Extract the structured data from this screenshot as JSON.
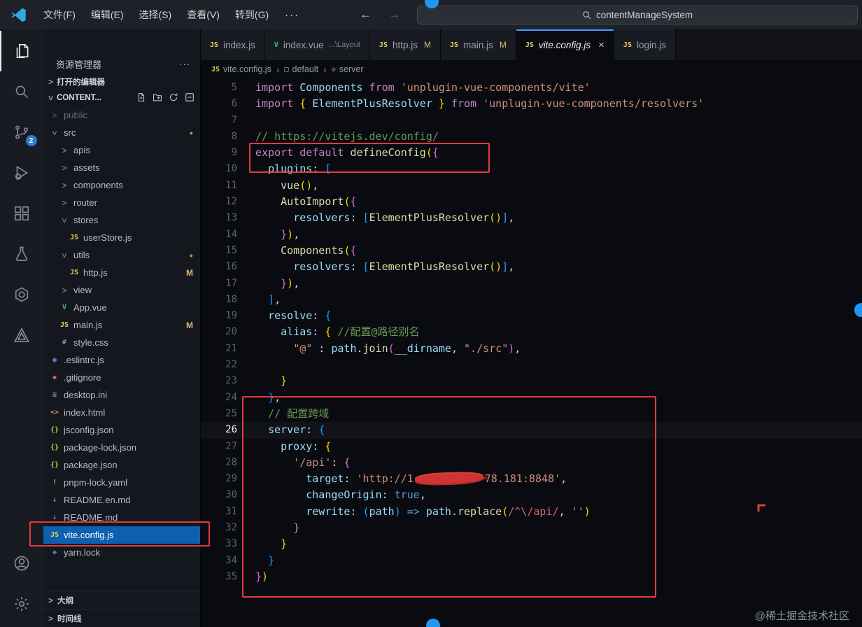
{
  "titlebar": {
    "menus": [
      "文件(F)",
      "编辑(E)",
      "选择(S)",
      "查看(V)",
      "转到(G)"
    ],
    "more": "···",
    "back": "←",
    "forward": "→",
    "search": "contentManageSystem"
  },
  "activity": {
    "items": [
      {
        "name": "explorer",
        "active": true
      },
      {
        "name": "search"
      },
      {
        "name": "source-control",
        "badge": "2"
      },
      {
        "name": "run-debug"
      },
      {
        "name": "extensions"
      },
      {
        "name": "testing"
      },
      {
        "name": "extension-hex"
      },
      {
        "name": "extension-triangle"
      }
    ],
    "bottom": [
      {
        "name": "account"
      },
      {
        "name": "settings"
      }
    ]
  },
  "sidebar": {
    "title": "资源管理器",
    "title_more": "···",
    "open_editors": "打开的编辑器",
    "section": "CONTENT...",
    "outline": "大纲",
    "timeline": "时间线",
    "tree": [
      {
        "label": "public",
        "level": 0,
        "kind": "folder",
        "expanded": false,
        "dim": true
      },
      {
        "label": "src",
        "level": 0,
        "kind": "folder",
        "expanded": true,
        "dot": true
      },
      {
        "label": "apis",
        "level": 1,
        "kind": "folder",
        "expanded": false
      },
      {
        "label": "assets",
        "level": 1,
        "kind": "folder",
        "expanded": false
      },
      {
        "label": "components",
        "level": 1,
        "kind": "folder",
        "expanded": false
      },
      {
        "label": "router",
        "level": 1,
        "kind": "folder",
        "expanded": false
      },
      {
        "label": "stores",
        "level": 1,
        "kind": "folder",
        "expanded": true
      },
      {
        "label": "userStore.js",
        "level": 2,
        "kind": "file",
        "icon": "js"
      },
      {
        "label": "utils",
        "level": 1,
        "kind": "folder",
        "expanded": true,
        "dot": true
      },
      {
        "label": "http.js",
        "level": 2,
        "kind": "file",
        "icon": "js",
        "badge": "M"
      },
      {
        "label": "view",
        "level": 1,
        "kind": "folder",
        "expanded": false
      },
      {
        "label": "App.vue",
        "level": 1,
        "kind": "file",
        "icon": "vue"
      },
      {
        "label": "main.js",
        "level": 1,
        "kind": "file",
        "icon": "js",
        "badge": "M"
      },
      {
        "label": "style.css",
        "level": 1,
        "kind": "file",
        "icon": "css"
      },
      {
        "label": ".eslintrc.js",
        "level": 0,
        "kind": "file",
        "icon": "eslint"
      },
      {
        "label": ".gitignore",
        "level": 0,
        "kind": "file",
        "icon": "git"
      },
      {
        "label": "desktop.ini",
        "level": 0,
        "kind": "file",
        "icon": "ini"
      },
      {
        "label": "index.html",
        "level": 0,
        "kind": "file",
        "icon": "html"
      },
      {
        "label": "jsconfig.json",
        "level": 0,
        "kind": "file",
        "icon": "json"
      },
      {
        "label": "package-lock.json",
        "level": 0,
        "kind": "file",
        "icon": "json"
      },
      {
        "label": "package.json",
        "level": 0,
        "kind": "file",
        "icon": "json"
      },
      {
        "label": "pnpm-lock.yaml",
        "level": 0,
        "kind": "file",
        "icon": "yaml"
      },
      {
        "label": "README.en.md",
        "level": 0,
        "kind": "file",
        "icon": "md"
      },
      {
        "label": "README.md",
        "level": 0,
        "kind": "file",
        "icon": "md"
      },
      {
        "label": "vite.config.js",
        "level": 0,
        "kind": "file",
        "icon": "js",
        "selected": true
      },
      {
        "label": "yarn.lock",
        "level": 0,
        "kind": "file",
        "icon": "lock"
      }
    ]
  },
  "tabs": [
    {
      "icon": "js",
      "label": "index.js"
    },
    {
      "icon": "vue",
      "label": "index.vue",
      "desc": "...\\Layout"
    },
    {
      "icon": "js",
      "label": "http.js",
      "badge": "M"
    },
    {
      "icon": "js",
      "label": "main.js",
      "badge": "M"
    },
    {
      "icon": "js",
      "label": "vite.config.js",
      "active": true,
      "close": "×"
    },
    {
      "icon": "js",
      "label": "login.js"
    }
  ],
  "breadcrumb": [
    {
      "icon": "js",
      "label": "vite.config.js"
    },
    {
      "icon": "box",
      "label": "default"
    },
    {
      "icon": "diamond",
      "label": "server"
    }
  ],
  "code": {
    "active_line": 26,
    "lines": [
      {
        "n": 5,
        "t": [
          [
            "k",
            "import "
          ],
          [
            "v",
            "Components "
          ],
          [
            "k",
            "from "
          ],
          [
            "s",
            "'unplugin-vue-components/vite'"
          ]
        ]
      },
      {
        "n": 6,
        "t": [
          [
            "k",
            "import "
          ],
          [
            "g",
            "{ "
          ],
          [
            "v",
            "ElementPlusResolver"
          ],
          [
            "g",
            " } "
          ],
          [
            "k",
            "from "
          ],
          [
            "s",
            "'unplugin-vue-components/resolvers'"
          ]
        ]
      },
      {
        "n": 7,
        "t": []
      },
      {
        "n": 8,
        "t": [
          [
            "c",
            "// https://vitejs.dev/config/"
          ]
        ]
      },
      {
        "n": 9,
        "t": [
          [
            "k",
            "export default "
          ],
          [
            "f",
            "defineConfig"
          ],
          [
            "g",
            "("
          ],
          [
            "m",
            "{"
          ]
        ]
      },
      {
        "n": 10,
        "t": [
          [
            "p",
            "  "
          ],
          [
            "v",
            "plugins"
          ],
          [
            "p",
            ": "
          ],
          [
            "b",
            "["
          ]
        ]
      },
      {
        "n": 11,
        "t": [
          [
            "p",
            "    "
          ],
          [
            "f",
            "vue"
          ],
          [
            "g",
            "()"
          ],
          [
            "p",
            ","
          ]
        ]
      },
      {
        "n": 12,
        "t": [
          [
            "p",
            "    "
          ],
          [
            "f",
            "AutoImport"
          ],
          [
            "g",
            "("
          ],
          [
            "m",
            "{"
          ]
        ]
      },
      {
        "n": 13,
        "t": [
          [
            "p",
            "      "
          ],
          [
            "v",
            "resolvers"
          ],
          [
            "p",
            ": "
          ],
          [
            "b",
            "["
          ],
          [
            "f",
            "ElementPlusResolver"
          ],
          [
            "g",
            "()"
          ],
          [
            "b",
            "]"
          ],
          [
            "p",
            ","
          ]
        ]
      },
      {
        "n": 14,
        "t": [
          [
            "p",
            "    "
          ],
          [
            "m",
            "}"
          ],
          [
            "g",
            ")"
          ],
          [
            "p",
            ","
          ]
        ]
      },
      {
        "n": 15,
        "t": [
          [
            "p",
            "    "
          ],
          [
            "f",
            "Components"
          ],
          [
            "g",
            "("
          ],
          [
            "m",
            "{"
          ]
        ]
      },
      {
        "n": 16,
        "t": [
          [
            "p",
            "      "
          ],
          [
            "v",
            "resolvers"
          ],
          [
            "p",
            ": "
          ],
          [
            "b",
            "["
          ],
          [
            "f",
            "ElementPlusResolver"
          ],
          [
            "g",
            "()"
          ],
          [
            "b",
            "]"
          ],
          [
            "p",
            ","
          ]
        ]
      },
      {
        "n": 17,
        "t": [
          [
            "p",
            "    "
          ],
          [
            "m",
            "}"
          ],
          [
            "g",
            ")"
          ],
          [
            "p",
            ","
          ]
        ]
      },
      {
        "n": 18,
        "t": [
          [
            "p",
            "  "
          ],
          [
            "b",
            "]"
          ],
          [
            "p",
            ","
          ]
        ]
      },
      {
        "n": 19,
        "t": [
          [
            "p",
            "  "
          ],
          [
            "v",
            "resolve"
          ],
          [
            "p",
            ": "
          ],
          [
            "b",
            "{"
          ]
        ]
      },
      {
        "n": 20,
        "t": [
          [
            "p",
            "    "
          ],
          [
            "v",
            "alias"
          ],
          [
            "p",
            ": "
          ],
          [
            "g",
            "{ "
          ],
          [
            "c",
            "//配置@路径别名"
          ]
        ]
      },
      {
        "n": 21,
        "t": [
          [
            "p",
            "      "
          ],
          [
            "s",
            "\"@\""
          ],
          [
            "p",
            " : "
          ],
          [
            "v",
            "path"
          ],
          [
            "p",
            "."
          ],
          [
            "f",
            "join"
          ],
          [
            "m",
            "("
          ],
          [
            "v",
            "__dirname"
          ],
          [
            "p",
            ", "
          ],
          [
            "s",
            "\"./src\""
          ],
          [
            "m",
            ")"
          ],
          [
            "p",
            ","
          ]
        ]
      },
      {
        "n": 22,
        "t": []
      },
      {
        "n": 23,
        "t": [
          [
            "p",
            "    "
          ],
          [
            "g",
            "}"
          ]
        ]
      },
      {
        "n": 24,
        "t": [
          [
            "p",
            "  "
          ],
          [
            "b",
            "}"
          ],
          [
            "p",
            ","
          ]
        ]
      },
      {
        "n": 25,
        "t": [
          [
            "p",
            "  "
          ],
          [
            "c",
            "// 配置跨域"
          ]
        ]
      },
      {
        "n": 26,
        "t": [
          [
            "p",
            "  "
          ],
          [
            "v",
            "server"
          ],
          [
            "p",
            ": "
          ],
          [
            "b",
            "{"
          ]
        ]
      },
      {
        "n": 27,
        "t": [
          [
            "p",
            "    "
          ],
          [
            "v",
            "proxy"
          ],
          [
            "p",
            ": "
          ],
          [
            "g",
            "{"
          ]
        ]
      },
      {
        "n": 28,
        "t": [
          [
            "p",
            "      "
          ],
          [
            "s",
            "'/api'"
          ],
          [
            "p",
            ": "
          ],
          [
            "m",
            "{"
          ]
        ]
      },
      {
        "n": 29,
        "t": [
          [
            "p",
            "        "
          ],
          [
            "v",
            "target"
          ],
          [
            "p",
            ": "
          ],
          [
            "s",
            "'http://1"
          ],
          [
            "x",
            ""
          ],
          [
            "s",
            "78.181:8848'"
          ],
          [
            "p",
            ","
          ]
        ]
      },
      {
        "n": 30,
        "t": [
          [
            "p",
            "        "
          ],
          [
            "v",
            "changeOrigin"
          ],
          [
            "p",
            ": "
          ],
          [
            "t",
            "true"
          ],
          [
            "p",
            ","
          ]
        ]
      },
      {
        "n": 31,
        "t": [
          [
            "p",
            "        "
          ],
          [
            "v",
            "rewrite"
          ],
          [
            "p",
            ": "
          ],
          [
            "b",
            "("
          ],
          [
            "v",
            "path"
          ],
          [
            "b",
            ")"
          ],
          [
            "p",
            " "
          ],
          [
            "t",
            "=>"
          ],
          [
            "p",
            " "
          ],
          [
            "v",
            "path"
          ],
          [
            "p",
            "."
          ],
          [
            "f",
            "replace"
          ],
          [
            "g",
            "("
          ],
          [
            "r",
            "/^\\/api/"
          ],
          [
            "p",
            ", "
          ],
          [
            "s",
            "''"
          ],
          [
            "g",
            ")"
          ]
        ]
      },
      {
        "n": 32,
        "t": [
          [
            "p",
            "      "
          ],
          [
            "m",
            "}"
          ]
        ]
      },
      {
        "n": 33,
        "t": [
          [
            "p",
            "    "
          ],
          [
            "g",
            "}"
          ]
        ]
      },
      {
        "n": 34,
        "t": [
          [
            "p",
            "  "
          ],
          [
            "b",
            "}"
          ]
        ]
      },
      {
        "n": 35,
        "t": [
          [
            "m",
            "}"
          ],
          [
            "g",
            ")"
          ]
        ]
      }
    ]
  },
  "watermark": "@稀土掘金技术社区"
}
